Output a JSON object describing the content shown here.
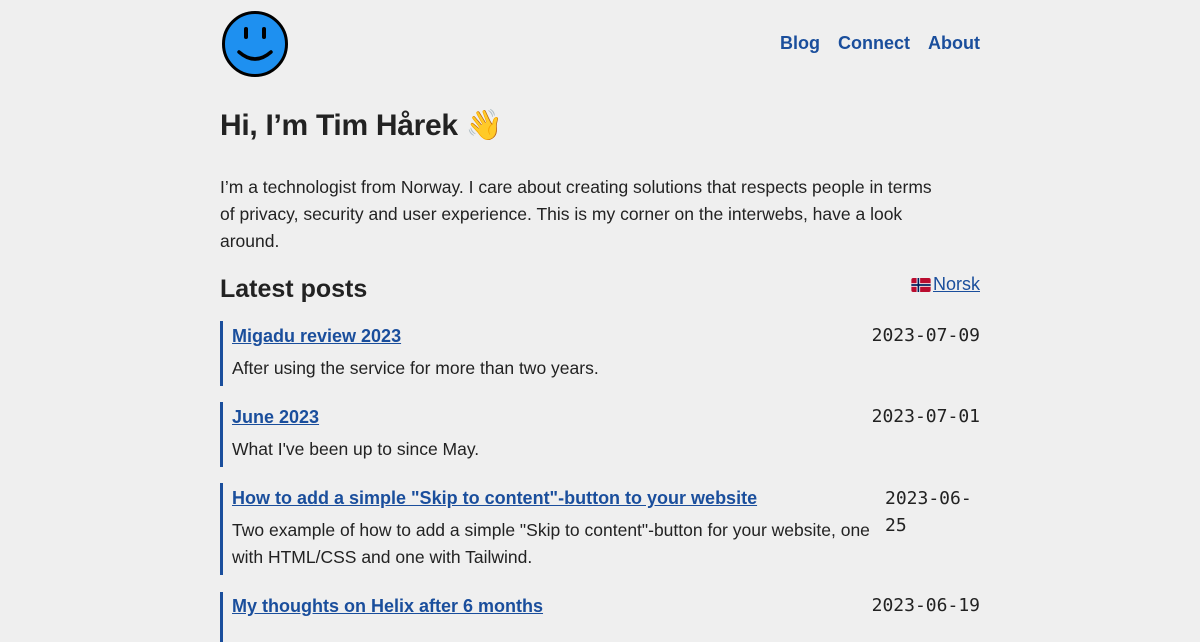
{
  "nav": {
    "blog": "Blog",
    "connect": "Connect",
    "about": "About"
  },
  "logo": {
    "icon": "smiley-face-icon",
    "fill_color": "#1e90f0"
  },
  "greeting": "Hi, I’m Tim Hårek 👋",
  "intro": "I’m a technologist from Norway. I care about creating solutions that respects people in terms of privacy, security and user experience. This is my corner on the interwebs, have a look around.",
  "latest_posts": {
    "heading": "Latest posts",
    "language_link": "Norsk",
    "language_icon": "norway-flag-icon",
    "posts": [
      {
        "title": "Migadu review 2023",
        "date": "2023-07-09",
        "description": "After using the service for more than two years."
      },
      {
        "title": "June 2023",
        "date": "2023-07-01",
        "description": "What I've been up to since May."
      },
      {
        "title": "How to add a simple \"Skip to content\"-button to your website",
        "date": "2023-06-25",
        "description": "Two example of how to add a simple \"Skip to content\"-button for your website, one with HTML/CSS and one with Tailwind."
      },
      {
        "title": "My thoughts on Helix after 6 months",
        "date": "2023-06-19",
        "description": ""
      }
    ]
  },
  "colors": {
    "background": "#efefef",
    "link": "#1a4e9c",
    "text": "#222222"
  }
}
